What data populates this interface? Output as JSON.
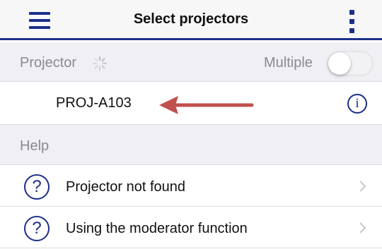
{
  "header": {
    "title": "Select projectors",
    "menu_icon": "hamburger-menu-icon",
    "more_icon": "vertical-more-icon",
    "accent_color": "#1c2f8a"
  },
  "projector_section": {
    "label": "Projector",
    "loading_icon": "loading-spinner-icon",
    "multiple_label": "Multiple",
    "multiple_toggle_on": false
  },
  "projector_list": [
    {
      "name": "PROJ-A103",
      "info_icon": "info-icon"
    }
  ],
  "annotation": {
    "icon": "red-arrow-icon",
    "color": "#c0504d"
  },
  "help_section": {
    "label": "Help",
    "items": [
      {
        "label": "Projector not found",
        "icon": "question-icon"
      },
      {
        "label": "Using the moderator function",
        "icon": "question-icon"
      }
    ]
  }
}
